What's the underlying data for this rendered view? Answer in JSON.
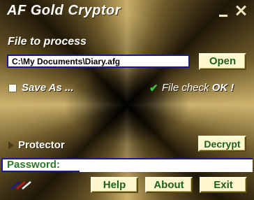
{
  "app": {
    "title": "AF Gold Cryptor"
  },
  "window_controls": {
    "minimize_icon": "minimize-icon",
    "close_icon": "close-icon"
  },
  "file": {
    "label": "File to process",
    "value": "C:\\My Documents\\Diary.afg",
    "open_label": "Open"
  },
  "options": {
    "save_as_label": "Save As ...",
    "save_as_checked": false,
    "file_check_prefix": "File check ",
    "file_check_status": "OK !",
    "check_icon": "check-icon"
  },
  "protector": {
    "label": "Protector",
    "icon": "triangle-right-icon"
  },
  "actions": {
    "decrypt_label": "Decrypt"
  },
  "password": {
    "label": "Password:",
    "value": ""
  },
  "footer": {
    "help_label": "Help",
    "about_label": "About",
    "exit_label": "Exit",
    "logo_icon": "pens-icon"
  },
  "colors": {
    "button_face": "#fff8cc",
    "button_text": "#1c5e1c",
    "field_border": "#1a1a8a",
    "check_green": "#3ec23e",
    "gold_light": "#cdb36d"
  }
}
